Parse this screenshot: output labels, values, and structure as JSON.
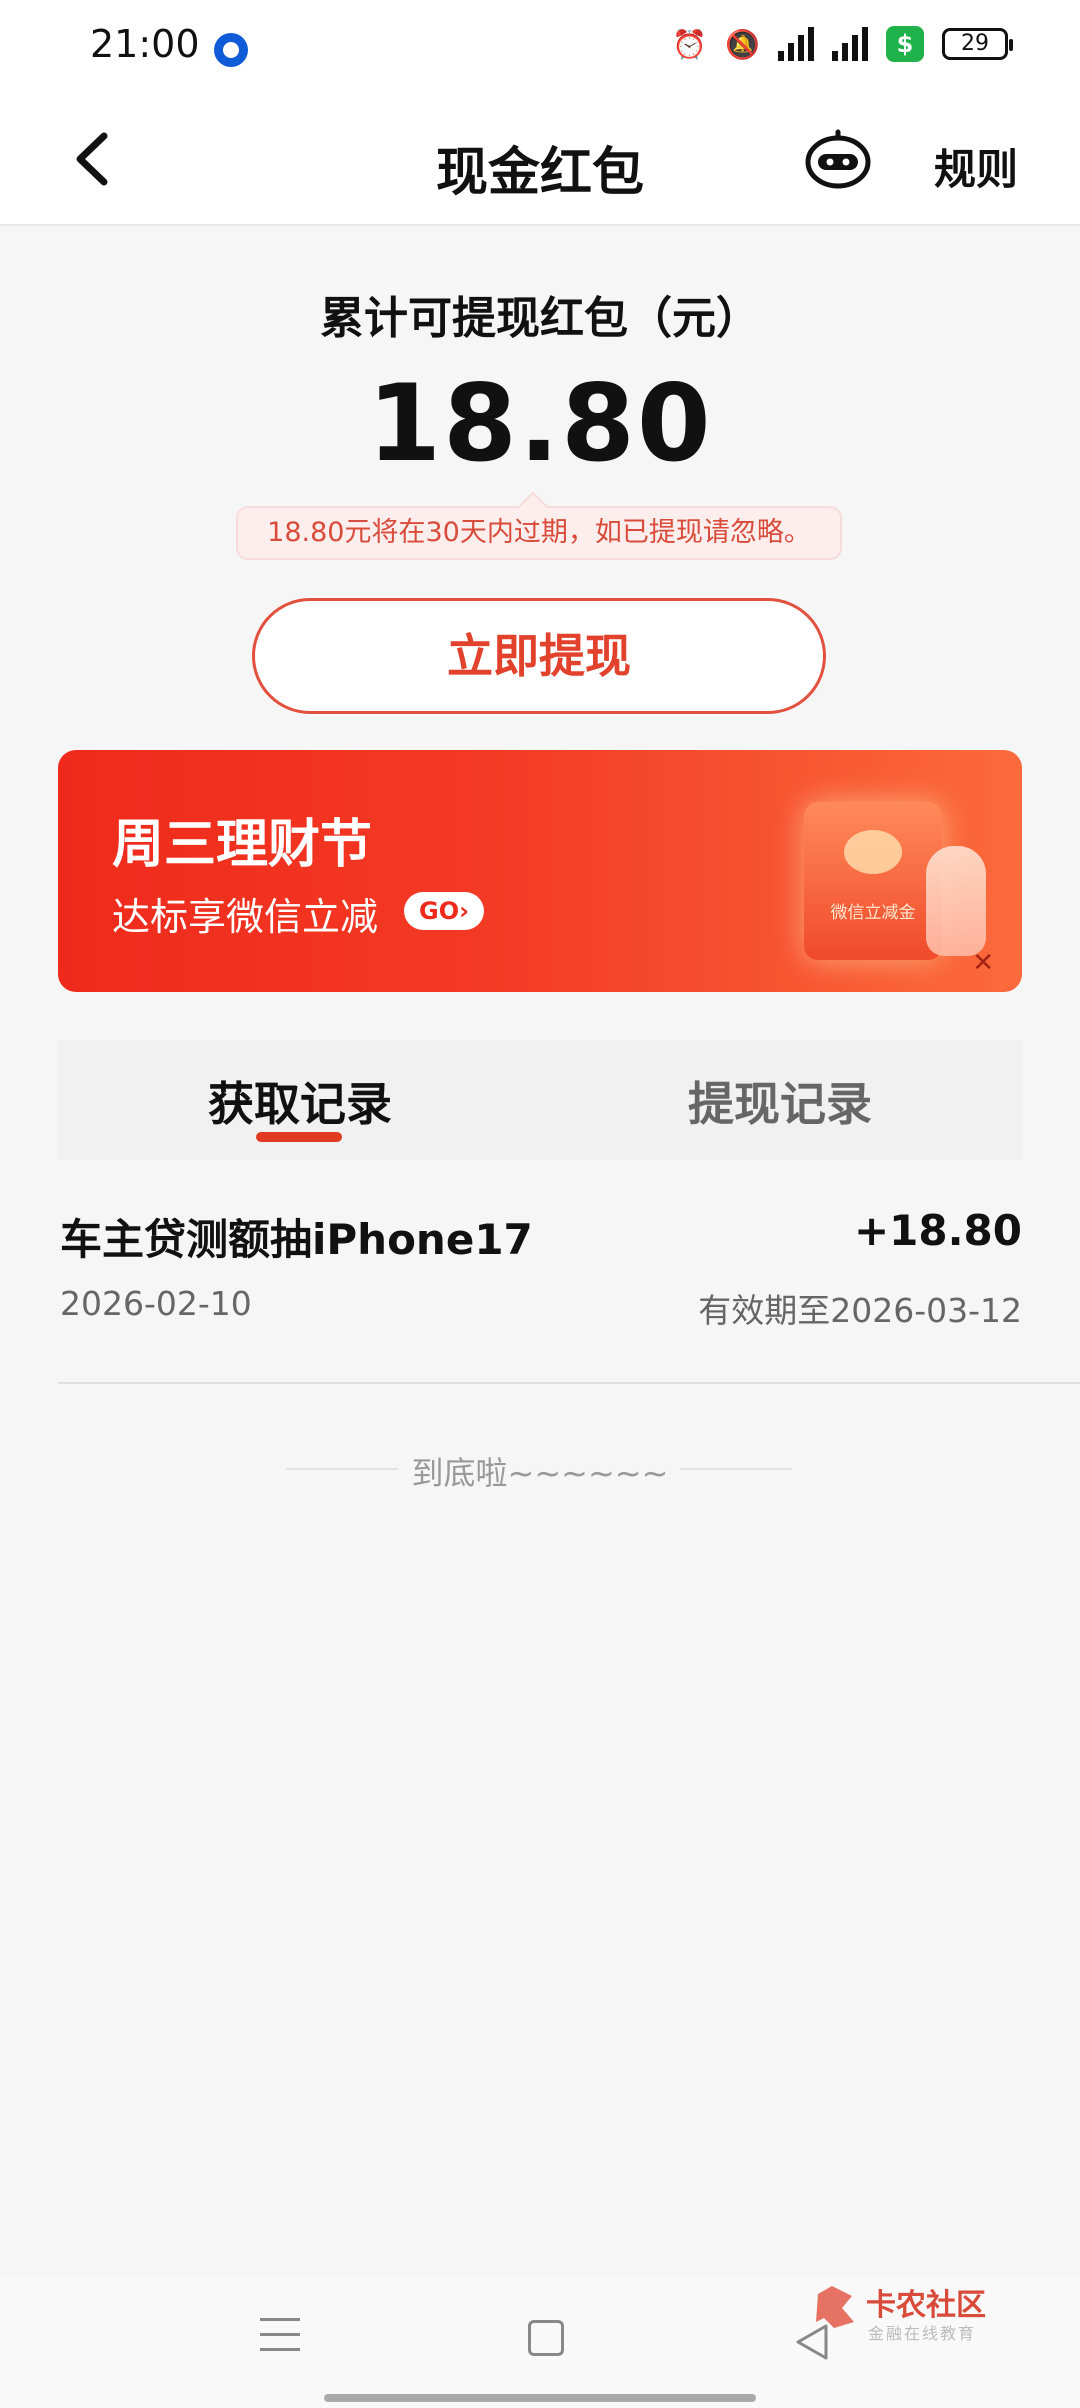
{
  "status": {
    "time": "21:00",
    "battery": "29"
  },
  "nav": {
    "title": "现金红包",
    "rules": "规则"
  },
  "summary": {
    "label": "累计可提现红包（元）",
    "amount": "18.80",
    "expire_tip": "18.80元将在30天内过期，如已提现请忽略。",
    "withdraw_button": "立即提现"
  },
  "banner": {
    "title": "周三理财节",
    "subtitle": "达标享微信立减",
    "go_label": "GO›",
    "envelope_label": "微信立减金"
  },
  "tabs": [
    {
      "label": "获取记录",
      "active": true
    },
    {
      "label": "提现记录",
      "active": false
    }
  ],
  "records": [
    {
      "title": "车主贷测额抽iPhone17",
      "amount": "+18.80",
      "date": "2026-02-10",
      "expiry": "有效期至2026-03-12"
    }
  ],
  "list_end": "到底啦~~~~~~",
  "watermark": {
    "title": "卡农社区",
    "subtitle": "金融在线教育"
  },
  "colors": {
    "accent": "#e2412c",
    "banner_start": "#ef2a1c",
    "banner_end": "#fb6a3c",
    "tip_background": "#fdeeee"
  }
}
